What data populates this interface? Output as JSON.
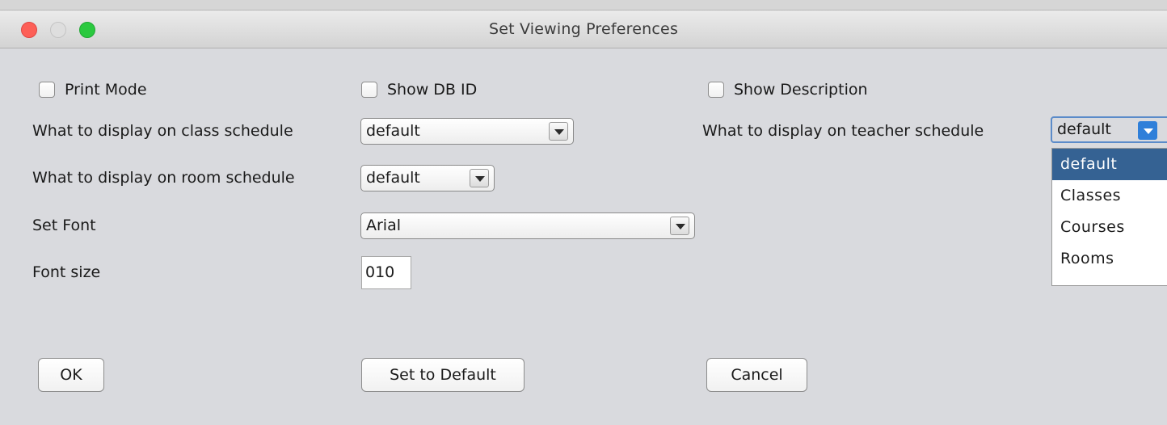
{
  "window": {
    "title": "Set Viewing Preferences"
  },
  "checkboxes": {
    "print_mode": "Print Mode",
    "show_db_id": "Show DB ID",
    "show_description": "Show Description"
  },
  "labels": {
    "class_schedule": "What to display on class schedule",
    "teacher_schedule": "What to display on teacher schedule",
    "room_schedule": "What to display on room schedule",
    "set_font": "Set Font",
    "font_size": "Font size"
  },
  "fields": {
    "class_schedule_value": "default",
    "teacher_schedule_value": "default",
    "room_schedule_value": "default",
    "font_value": "Arial",
    "font_size_value": "010"
  },
  "dropdown_options": [
    "default",
    "Classes",
    "Courses",
    "Rooms"
  ],
  "dropdown_selected": "default",
  "buttons": {
    "ok": "OK",
    "set_default": "Set to Default",
    "cancel": "Cancel"
  },
  "colors": {
    "selection": "#356293",
    "focus": "#5b8bc9"
  }
}
